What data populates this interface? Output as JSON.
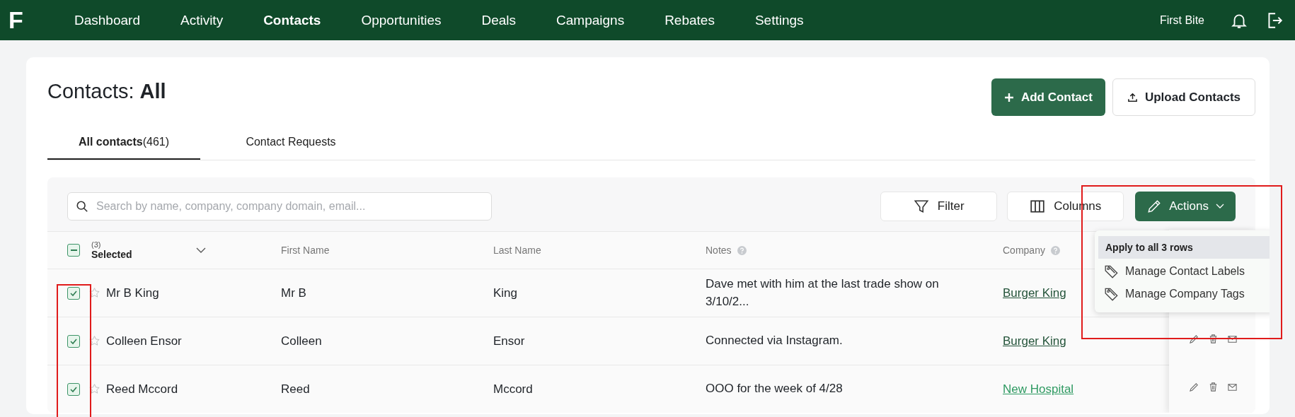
{
  "nav": {
    "logo": "F",
    "items": [
      {
        "label": "Dashboard",
        "selected": false
      },
      {
        "label": "Activity",
        "selected": false
      },
      {
        "label": "Contacts",
        "selected": true
      },
      {
        "label": "Opportunities",
        "selected": false
      },
      {
        "label": "Deals",
        "selected": false
      },
      {
        "label": "Campaigns",
        "selected": false
      },
      {
        "label": "Rebates",
        "selected": false
      },
      {
        "label": "Settings",
        "selected": false
      }
    ],
    "account": "First Bite"
  },
  "page": {
    "title_prefix": "Contacts:",
    "title_bold": "All",
    "buttons": [
      {
        "label": "Add Contact",
        "kind": "primary"
      },
      {
        "label": "Upload Contacts",
        "kind": "secondary"
      }
    ]
  },
  "tabs": [
    {
      "label": "All contacts",
      "count": "(461)",
      "selected": true
    },
    {
      "label": "Contact Requests",
      "selected": false
    }
  ],
  "toolbar": {
    "search": {
      "placeholder": "Search by name, company, company domain, email..."
    },
    "filter": "Filter",
    "columns": "Columns",
    "actions": "Actions"
  },
  "actions_menu": {
    "heading": "Apply to all 3 rows",
    "items": [
      "Manage Contact Labels",
      "Manage Company Tags"
    ]
  },
  "table": {
    "select_count": "(3)",
    "select_label": "Selected",
    "partially_checked": true,
    "columns": [
      {
        "label": "First Name",
        "help": false
      },
      {
        "label": "Last Name",
        "help": false
      },
      {
        "label": "Notes",
        "help": true
      },
      {
        "label": "Company",
        "help": true
      }
    ],
    "rows": [
      {
        "checked": true,
        "starred": false,
        "name": "Mr B King",
        "first": "Mr B",
        "last": "King",
        "notes": "Dave met with him at the last trade show on 3/10/2...",
        "company": "Burger King",
        "color": "#24543a"
      },
      {
        "checked": true,
        "starred": false,
        "name": "Colleen Ensor",
        "first": "Colleen",
        "last": "Ensor",
        "notes": "Connected via Instagram.",
        "company": "Burger King",
        "color": "#24543a"
      },
      {
        "checked": true,
        "starred": false,
        "name": "Reed Mccord",
        "first": "Reed",
        "last": "Mccord",
        "notes": "OOO for the week of 4/28",
        "company": "New Hospital",
        "color": "#2f9a62"
      }
    ]
  }
}
